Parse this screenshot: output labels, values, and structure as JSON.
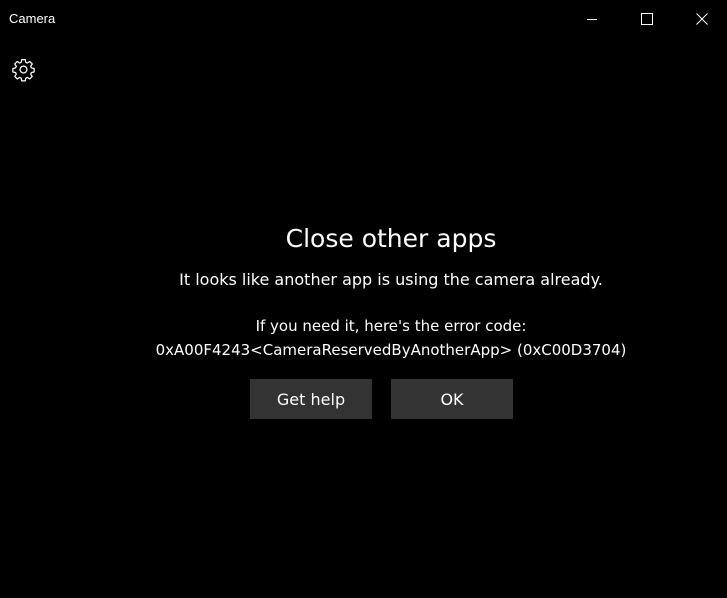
{
  "window": {
    "title": "Camera"
  },
  "titlebar": {
    "minimize_icon": "minimize-icon",
    "maximize_icon": "maximize-icon",
    "close_icon": "close-icon"
  },
  "toolbar": {
    "settings_icon": "gear-icon"
  },
  "dialog": {
    "heading": "Close other apps",
    "message": "It looks like another app is using the camera already.",
    "error_intro": "If you need it, here's the error code:",
    "error_code": "0xA00F4243<CameraReservedByAnotherApp> (0xC00D3704)",
    "help_label": "Get help",
    "ok_label": "OK"
  },
  "colors": {
    "background": "#000000",
    "text": "#ffffff",
    "button": "#333333"
  }
}
